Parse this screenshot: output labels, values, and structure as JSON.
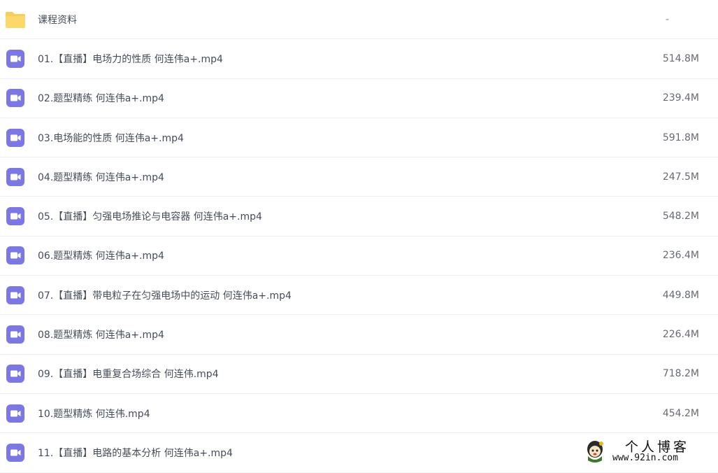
{
  "colors": {
    "folder_icon": "#f9cd5a",
    "video_icon": "#7b77e6",
    "row_divider": "#f0f0f2",
    "name_text": "#454d5a",
    "size_text": "#666a72"
  },
  "files": [
    {
      "type": "folder",
      "icon": "folder-icon",
      "name": "课程资料",
      "size": "-"
    },
    {
      "type": "video",
      "icon": "video-icon",
      "name": "01.【直播】电场力的性质 何连伟a+.mp4",
      "size": "514.8M"
    },
    {
      "type": "video",
      "icon": "video-icon",
      "name": "02.题型精练 何连伟a+.mp4",
      "size": "239.4M"
    },
    {
      "type": "video",
      "icon": "video-icon",
      "name": "03.电场能的性质 何连伟a+.mp4",
      "size": "591.8M"
    },
    {
      "type": "video",
      "icon": "video-icon",
      "name": "04.题型精练 何连伟a+.mp4",
      "size": "247.5M"
    },
    {
      "type": "video",
      "icon": "video-icon",
      "name": "05.【直播】匀强电场推论与电容器 何连伟a+.mp4",
      "size": "548.2M"
    },
    {
      "type": "video",
      "icon": "video-icon",
      "name": "06.题型精炼 何连伟a+.mp4",
      "size": "236.4M"
    },
    {
      "type": "video",
      "icon": "video-icon",
      "name": "07.【直播】带电粒子在匀强电场中的运动 何连伟a+.mp4",
      "size": "449.8M"
    },
    {
      "type": "video",
      "icon": "video-icon",
      "name": "08.题型精炼 何连伟a+.mp4",
      "size": "226.4M"
    },
    {
      "type": "video",
      "icon": "video-icon",
      "name": "09.【直播】电重复合场综合 何连伟.mp4",
      "size": "718.2M"
    },
    {
      "type": "video",
      "icon": "video-icon",
      "name": "10.题型精炼 何连伟.mp4",
      "size": "454.2M"
    },
    {
      "type": "video",
      "icon": "video-icon",
      "name": "11.【直播】电路的基本分析 何连伟a+.mp4",
      "size": ""
    }
  ],
  "watermark": {
    "title": "个人博客",
    "url": "www.92in.com",
    "icon": "mascot-icon"
  }
}
